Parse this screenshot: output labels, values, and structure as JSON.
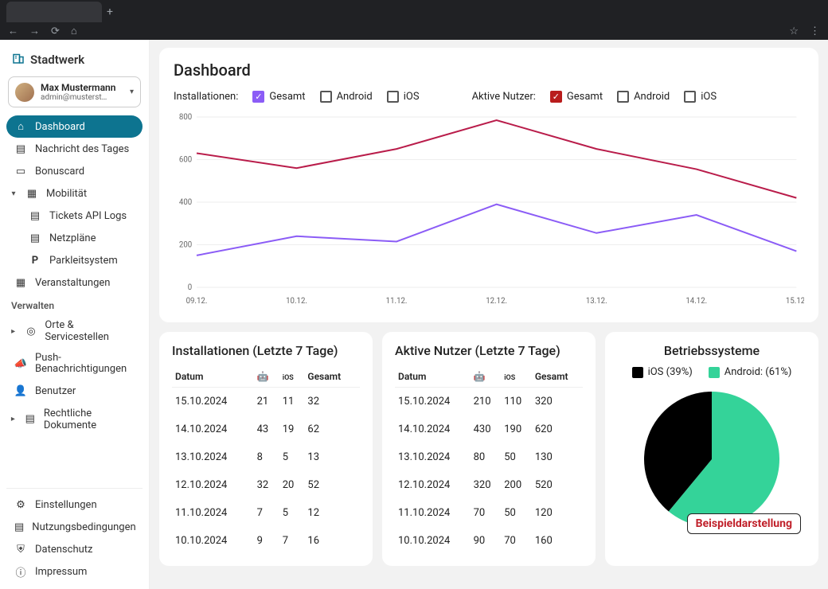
{
  "brand": "Stadtwerk",
  "user": {
    "name": "Max Mustermann",
    "email": "admin@musterst…"
  },
  "nav": {
    "dashboard": "Dashboard",
    "nachricht": "Nachricht des Tages",
    "bonuscard": "Bonuscard",
    "mobilitaet": "Mobilität",
    "tickets": "Tickets API Logs",
    "netzplaene": "Netzpläne",
    "parkleit": "Parkleitsystem",
    "veranstaltungen": "Veranstaltungen",
    "verwalten": "Verwalten",
    "orte": "Orte & Servicestellen",
    "push": "Push-Benachrichtigungen",
    "benutzer": "Benutzer",
    "rechtliche": "Rechtliche Dokumente",
    "einstellungen": "Einstellungen",
    "nutzung": "Nutzungsbedingungen",
    "datenschutz": "Datenschutz",
    "impressum": "Impressum"
  },
  "page": {
    "title": "Dashboard",
    "filter_install_label": "Installationen:",
    "filter_active_label": "Aktive Nutzer:",
    "opt_gesamt": "Gesamt",
    "opt_android": "Android",
    "opt_ios": "iOS"
  },
  "tables": {
    "install_title": "Installationen (Letzte 7 Tage)",
    "active_title": "Aktive Nutzer (Letzte 7 Tage)",
    "col_date": "Datum",
    "col_gesamt": "Gesamt",
    "col_ios": "iOS",
    "install_rows": [
      {
        "date": "15.10.2024",
        "android": "21",
        "ios": "11",
        "total": "32"
      },
      {
        "date": "14.10.2024",
        "android": "43",
        "ios": "19",
        "total": "62"
      },
      {
        "date": "13.10.2024",
        "android": "8",
        "ios": "5",
        "total": "13"
      },
      {
        "date": "12.10.2024",
        "android": "32",
        "ios": "20",
        "total": "52"
      },
      {
        "date": "11.10.2024",
        "android": "7",
        "ios": "5",
        "total": "12"
      },
      {
        "date": "10.10.2024",
        "android": "9",
        "ios": "7",
        "total": "16"
      }
    ],
    "active_rows": [
      {
        "date": "15.10.2024",
        "android": "210",
        "ios": "110",
        "total": "320"
      },
      {
        "date": "14.10.2024",
        "android": "430",
        "ios": "190",
        "total": "620"
      },
      {
        "date": "13.10.2024",
        "android": "80",
        "ios": "50",
        "total": "130"
      },
      {
        "date": "12.10.2024",
        "android": "320",
        "ios": "200",
        "total": "520"
      },
      {
        "date": "11.10.2024",
        "android": "70",
        "ios": "50",
        "total": "120"
      },
      {
        "date": "10.10.2024",
        "android": "90",
        "ios": "70",
        "total": "160"
      }
    ]
  },
  "os": {
    "title": "Betriebssysteme",
    "ios_label": "iOS (39%)",
    "android_label": "Android: (61%)",
    "badge": "Beispieldarstellung",
    "colors": {
      "ios": "#000000",
      "android": "#34d399"
    }
  },
  "chart_data": [
    {
      "type": "line",
      "title": "Dashboard",
      "categories": [
        "09.12.",
        "10.12.",
        "11.12.",
        "12.12.",
        "13.12.",
        "14.12.",
        "15.12."
      ],
      "ylim": [
        0,
        800
      ],
      "yticks": [
        0,
        200,
        400,
        600,
        800
      ],
      "series": [
        {
          "name": "Installationen Gesamt",
          "color": "#8b5cf6",
          "values": [
            150,
            240,
            215,
            390,
            255,
            340,
            170
          ]
        },
        {
          "name": "Aktive Nutzer Gesamt",
          "color": "#b91c4a",
          "values": [
            630,
            560,
            650,
            785,
            650,
            555,
            420
          ]
        }
      ]
    },
    {
      "type": "pie",
      "title": "Betriebssysteme",
      "series": [
        {
          "name": "iOS",
          "value": 39,
          "color": "#000000"
        },
        {
          "name": "Android",
          "value": 61,
          "color": "#34d399"
        }
      ]
    }
  ]
}
